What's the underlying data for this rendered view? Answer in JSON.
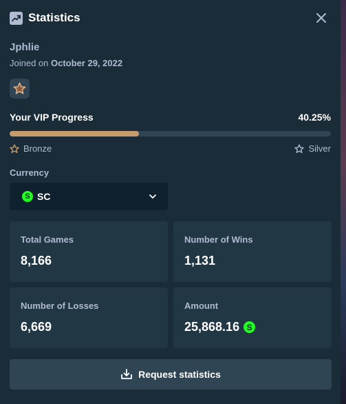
{
  "modal": {
    "title": "Statistics",
    "title_icon": "trending-chart-icon",
    "close_icon": "close-icon"
  },
  "user": {
    "username": "Jphlie",
    "joined_prefix": "Joined on",
    "joined_date": "October 29, 2022",
    "badge_icon": "star-badge-icon"
  },
  "vip": {
    "label": "Your VIP Progress",
    "percent_text": "40.25%",
    "progress_fraction": 0.4025,
    "current_tier": "Bronze",
    "next_tier": "Silver",
    "fill_color": "#c69c6d"
  },
  "currency": {
    "label": "Currency",
    "selected": "SC",
    "coin_symbol": "S",
    "coin_color": "#1fff20",
    "dropdown_icon": "chevron-down-icon"
  },
  "stats": [
    {
      "label": "Total Games",
      "value": "8,166"
    },
    {
      "label": "Number of Wins",
      "value": "1,131"
    },
    {
      "label": "Number of Losses",
      "value": "6,669"
    },
    {
      "label": "Amount",
      "value": "25,868.16",
      "coin_symbol": "S"
    }
  ],
  "request_button": {
    "label": "Request statistics",
    "icon": "download-icon"
  }
}
